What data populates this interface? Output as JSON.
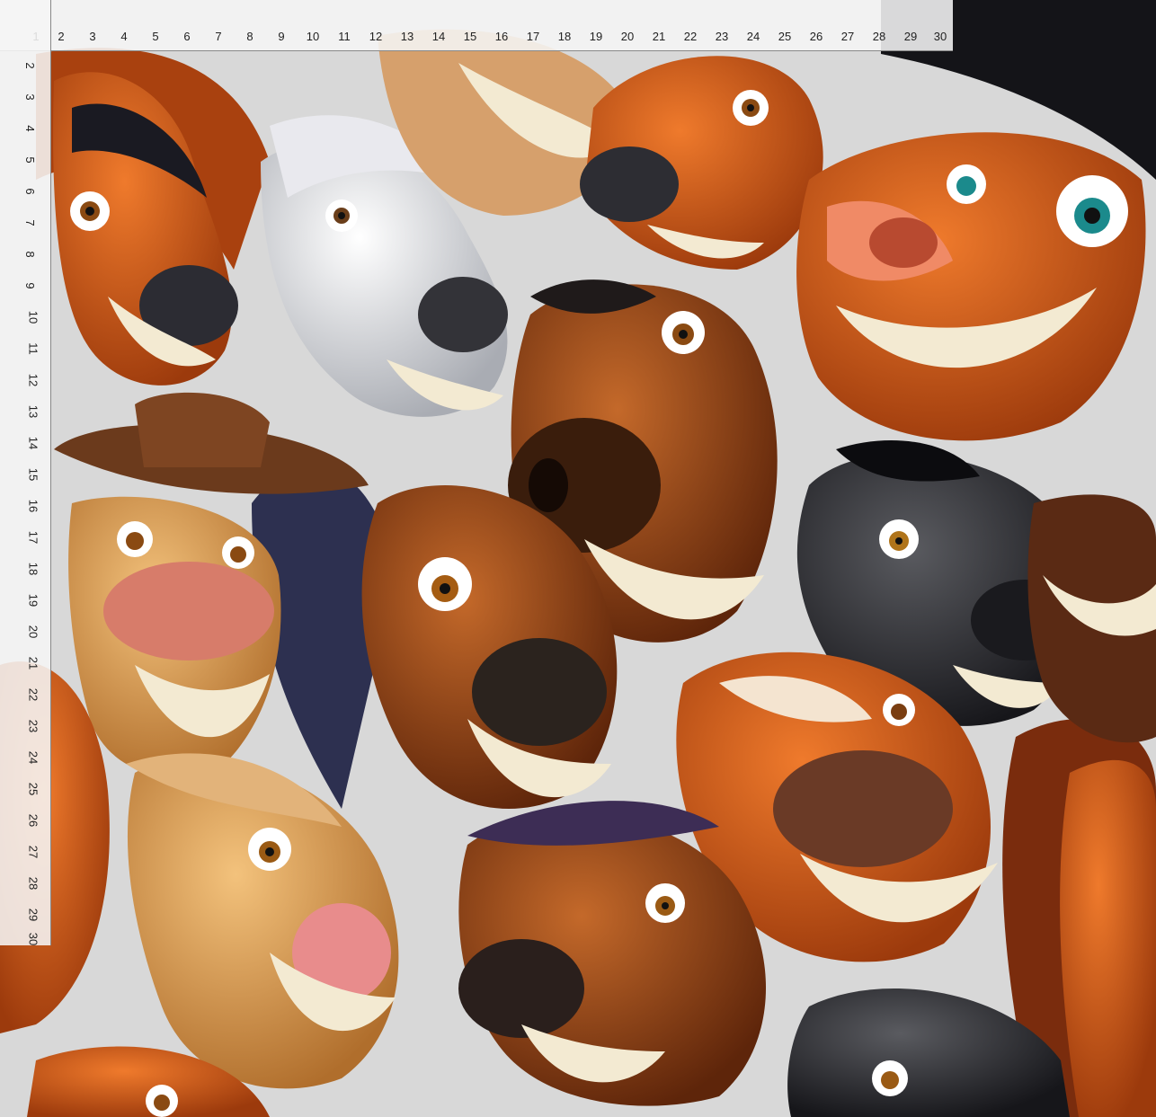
{
  "pattern": {
    "subject": "cartoon horse faces",
    "palette": {
      "background": "#d8d8d8",
      "chestnut": "#c24f14",
      "bay": "#8a3c12",
      "palomino": "#d99a4e",
      "grey": "#d9dadc",
      "black": "#2b2b2e",
      "mane_purple": "#3d2d55",
      "teeth": "#f3ead2",
      "mouth": "#c9333a",
      "hat": "#6b3a1c"
    }
  },
  "ruler": {
    "top_numbers": [
      "1",
      "2",
      "3",
      "4",
      "5",
      "6",
      "7",
      "8",
      "9",
      "10",
      "11",
      "12",
      "13",
      "14",
      "15",
      "16",
      "17",
      "18",
      "19",
      "20",
      "21",
      "22",
      "23",
      "24",
      "25",
      "26",
      "27",
      "28",
      "29",
      "30"
    ],
    "left_numbers": [
      "2",
      "3",
      "4",
      "5",
      "6",
      "7",
      "8",
      "9",
      "10",
      "11",
      "12",
      "13",
      "14",
      "15",
      "16",
      "17",
      "18",
      "19",
      "20",
      "21",
      "22",
      "23",
      "24",
      "25",
      "26",
      "27",
      "28",
      "29",
      "30"
    ]
  }
}
